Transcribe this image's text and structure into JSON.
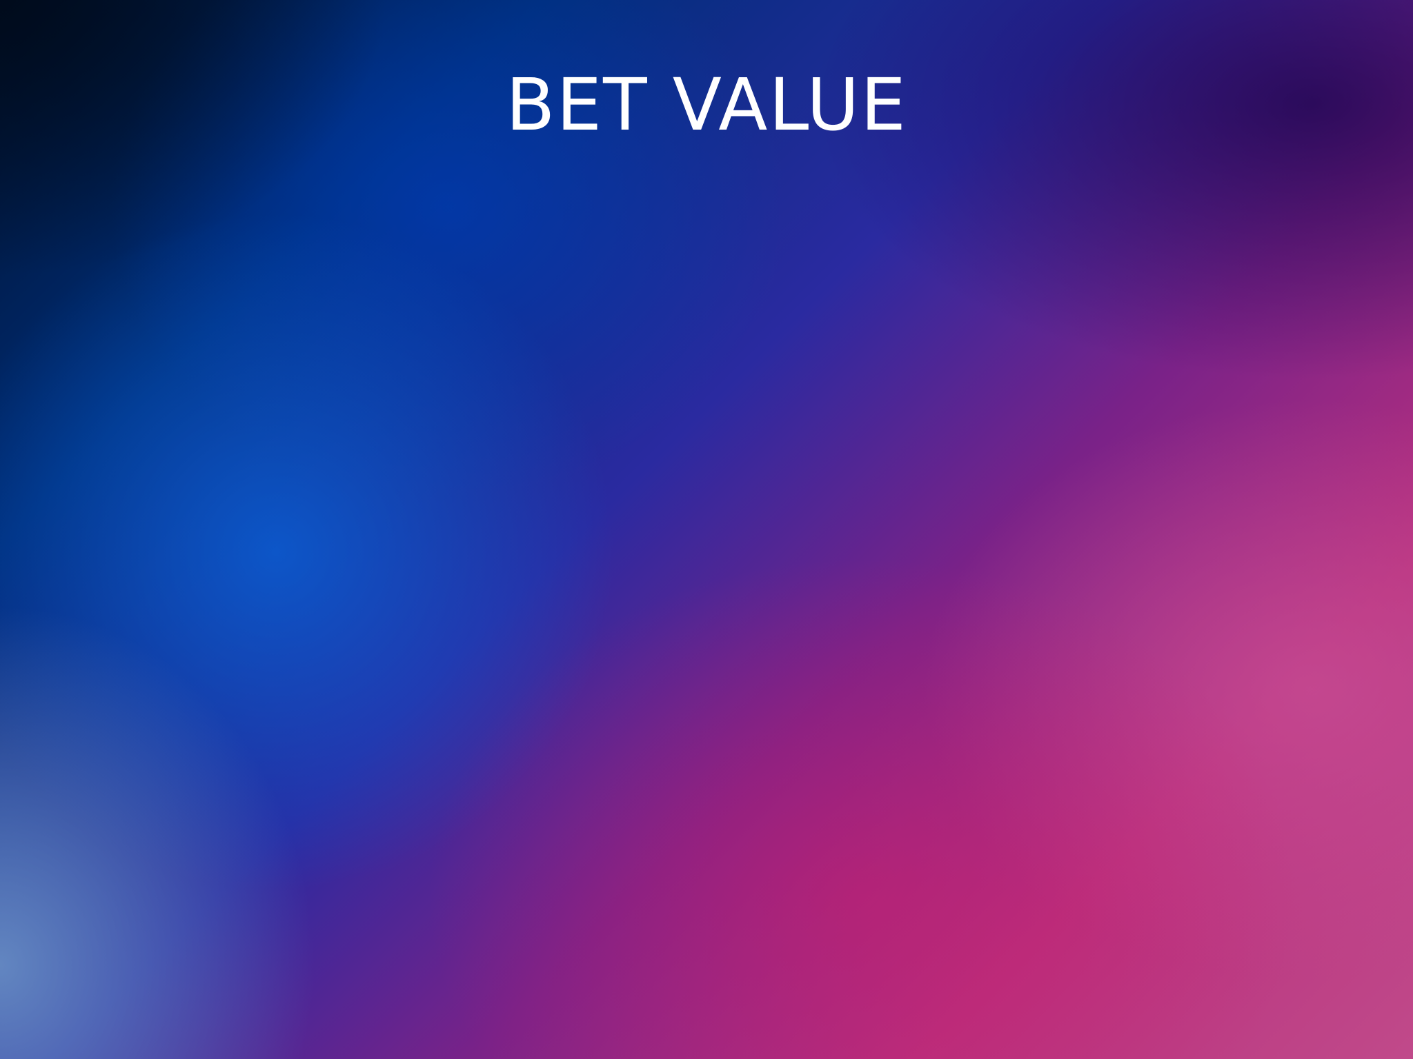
{
  "screen": {
    "title": "BET VALUE"
  },
  "colors": {
    "title_text": "#ffffff",
    "bg_top_left": "#00102a",
    "bg_mid_blue": "#0050c8",
    "bg_purple": "#6a2a90",
    "bg_pink": "#c0357e"
  }
}
